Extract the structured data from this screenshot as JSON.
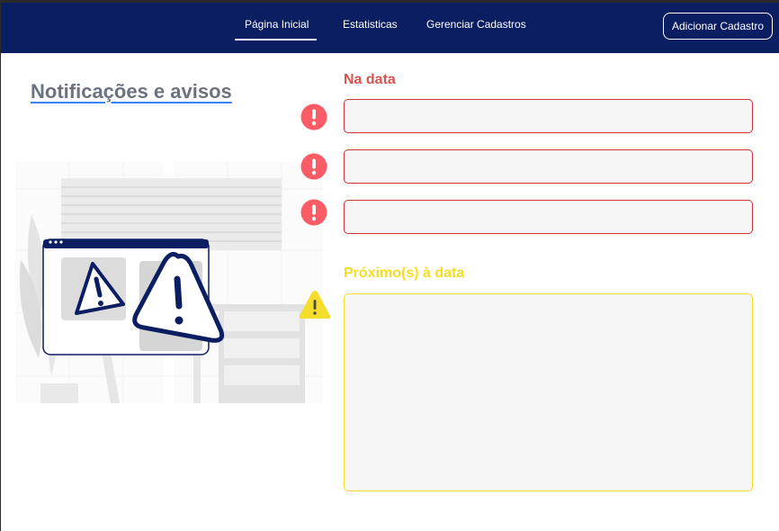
{
  "nav": {
    "links": [
      {
        "label": "Página Inicial",
        "active": true
      },
      {
        "label": "Estatisticas",
        "active": false
      },
      {
        "label": "Gerenciar Cadastros",
        "active": false
      }
    ],
    "add_button_label": "Adicionar Cadastro"
  },
  "page": {
    "title": "Notificações e avisos"
  },
  "sections": {
    "on_date": {
      "heading": "Na data",
      "fields": [
        {
          "value": "",
          "icon": "exclamation-circle-icon"
        },
        {
          "value": "",
          "icon": "exclamation-circle-icon"
        },
        {
          "value": "",
          "icon": "exclamation-circle-icon"
        }
      ],
      "color": "#d9534f"
    },
    "near_date": {
      "heading": "Próximo(s) à data",
      "value": "",
      "icon": "warning-triangle-icon",
      "color": "#f7dc20"
    }
  },
  "colors": {
    "navbar": "#0b1e61",
    "alert_red": "#fc5c65",
    "warning_yellow": "#f5dd2b",
    "illustration_navy": "#0b1e61"
  }
}
